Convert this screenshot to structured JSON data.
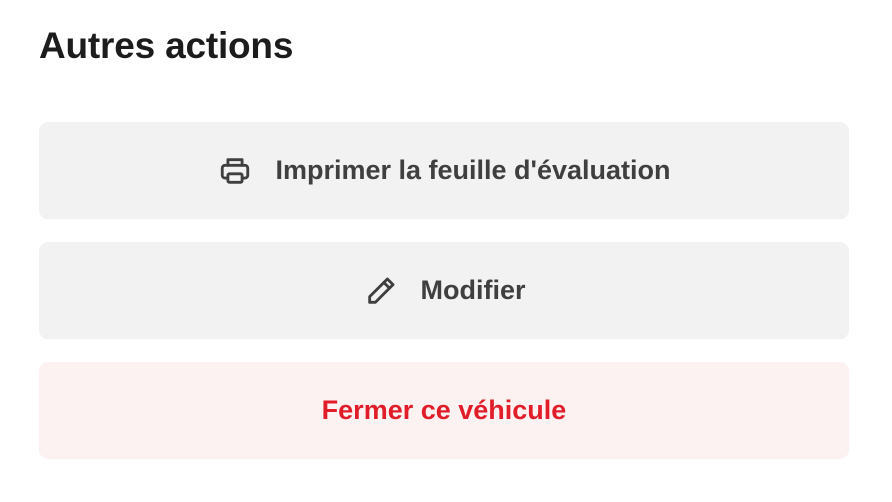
{
  "section": {
    "title": "Autres actions"
  },
  "actions": {
    "print": {
      "label": "Imprimer la feuille d'évaluation",
      "icon": "printer-icon"
    },
    "edit": {
      "label": "Modifier",
      "icon": "pencil-icon"
    },
    "close_vehicle": {
      "label": "Fermer ce véhicule"
    }
  },
  "colors": {
    "neutral_bg": "#f2f2f2",
    "neutral_text": "#3f3f3f",
    "danger_bg": "#fdf2f2",
    "danger_text": "#e11d2a"
  }
}
